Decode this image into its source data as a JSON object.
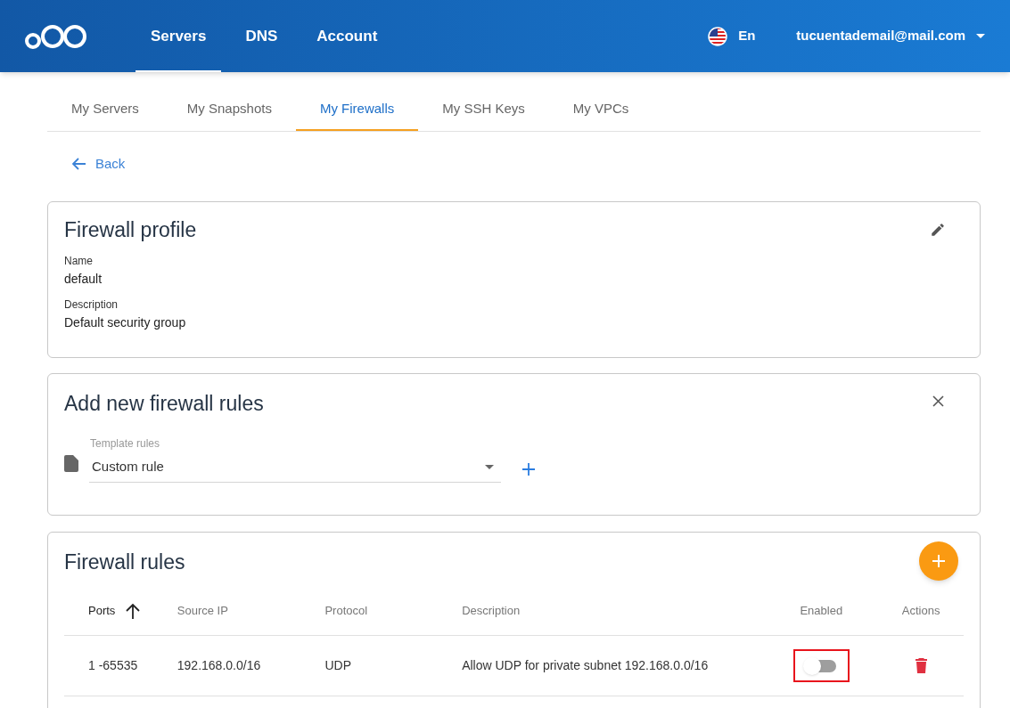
{
  "header": {
    "nav": [
      {
        "label": "Servers",
        "selected": true
      },
      {
        "label": "DNS",
        "selected": false
      },
      {
        "label": "Account",
        "selected": false
      }
    ],
    "language": "En",
    "account": "tucuentademail@mail.com"
  },
  "tabs": [
    {
      "label": "My Servers",
      "selected": false
    },
    {
      "label": "My Snapshots",
      "selected": false
    },
    {
      "label": "My Firewalls",
      "selected": true
    },
    {
      "label": "My SSH Keys",
      "selected": false
    },
    {
      "label": "My VPCs",
      "selected": false
    }
  ],
  "back": "Back",
  "profile": {
    "title": "Firewall profile",
    "fields": [
      {
        "label": "Name",
        "value": "default"
      },
      {
        "label": "Description",
        "value": "Default security group"
      }
    ]
  },
  "add_rules": {
    "title": "Add new firewall rules",
    "template": {
      "label": "Template rules",
      "value": "Custom rule"
    }
  },
  "rules": {
    "title": "Firewall rules",
    "columns": [
      "Ports",
      "Source IP",
      "Protocol",
      "Description",
      "Enabled",
      "Actions"
    ],
    "rows": [
      {
        "ports": "1 -65535",
        "source_ip": "192.168.0.0/16",
        "protocol": "UDP",
        "description": "Allow UDP for private subnet 192.168.0.0/16",
        "enabled": false,
        "highlighted": true
      }
    ]
  }
}
